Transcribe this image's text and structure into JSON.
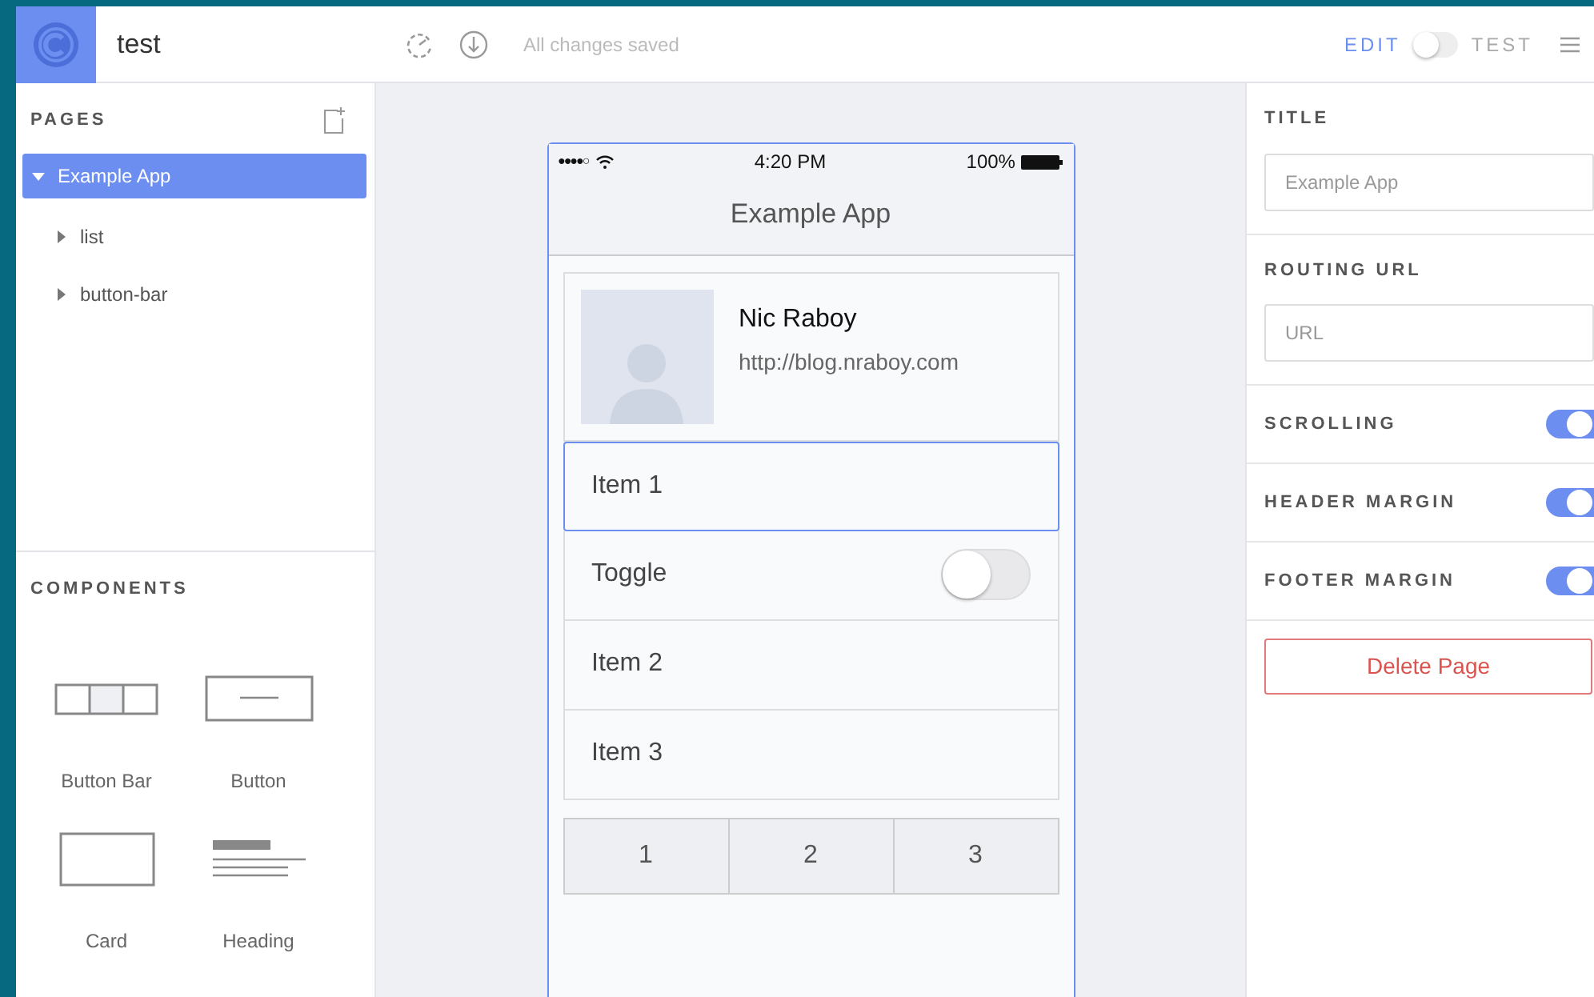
{
  "app": {
    "project_name": "test",
    "save_status": "All changes saved"
  },
  "mode": {
    "edit_label": "EDIT",
    "test_label": "TEST",
    "test_on": false
  },
  "pages": {
    "heading": "PAGES",
    "tree": [
      {
        "label": "Example App",
        "selected": true,
        "expanded": true,
        "children": [
          {
            "label": "list",
            "selected": false,
            "expanded": false
          },
          {
            "label": "button-bar",
            "selected": false,
            "expanded": false
          }
        ]
      }
    ]
  },
  "components": {
    "heading": "COMPONENTS",
    "items": [
      {
        "label": "Button Bar",
        "kind": "buttonbar"
      },
      {
        "label": "Button",
        "kind": "button"
      },
      {
        "label": "Card",
        "kind": "card"
      },
      {
        "label": "Heading",
        "kind": "heading"
      }
    ]
  },
  "phone": {
    "signal": "●●●●○",
    "time": "4:20 PM",
    "battery": "100%",
    "title": "Example App",
    "profile": {
      "name": "Nic Raboy",
      "url": "http://blog.nraboy.com"
    },
    "list": [
      {
        "kind": "item",
        "label": "Item 1",
        "selected": true
      },
      {
        "kind": "toggle",
        "label": "Toggle",
        "selected": false,
        "on": false
      },
      {
        "kind": "item",
        "label": "Item 2",
        "selected": false
      },
      {
        "kind": "item",
        "label": "Item 3",
        "selected": false
      }
    ],
    "button_bar": [
      "1",
      "2",
      "3"
    ]
  },
  "properties": {
    "fields": [
      {
        "label": "TITLE",
        "placeholder": "Example App"
      },
      {
        "label": "ROUTING URL",
        "placeholder": "URL"
      }
    ],
    "toggles": [
      {
        "label": "SCROLLING",
        "on": true
      },
      {
        "label": "HEADER MARGIN",
        "on": true
      },
      {
        "label": "FOOTER MARGIN",
        "on": true
      }
    ],
    "delete_button": "Delete Page"
  }
}
